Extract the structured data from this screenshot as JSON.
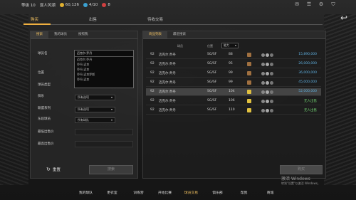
{
  "topbar": {
    "level": "等级 10",
    "mode": "混人风潮",
    "gold": "60,126",
    "points": "4/10",
    "extra": "8"
  },
  "main_tabs": [
    {
      "label": "购买"
    },
    {
      "label": "出售"
    },
    {
      "label": "待收交易"
    }
  ],
  "left": {
    "subtabs": [
      "搜索",
      "我的球员",
      "按照我"
    ],
    "fields": {
      "player_name_label": "球员名",
      "position_label": "位置",
      "card_type_label": "球员类型",
      "club_label": "俱乐",
      "league_label": "联盟系列",
      "team_label": "东段球员",
      "min_price_label": "最低出售价",
      "max_price_label": "最高出售价"
    },
    "dropdown": {
      "current": "迈克尔.乔丹",
      "options": [
        "迈克尔.乔丹",
        "乔丹.迈克",
        "乔丹.迈克",
        "乔丹.迈克罗斯",
        "乔丹.迈克"
      ]
    },
    "selects": {
      "club": "所有选项",
      "league": "所有选项",
      "team": "所有球队"
    },
    "reset_label": "重置",
    "search_label": "搜索"
  },
  "right": {
    "tabs": [
      "商品列表",
      "最近搜索"
    ],
    "headers": {
      "player": "球员",
      "position": "位置",
      "ability": "能力",
      "sort": "能力"
    },
    "rows": [
      {
        "num": "92",
        "name": "迈克尔.乔丹",
        "pos": "SG/SF",
        "ovr": "88",
        "price": "15,890,000",
        "green": false
      },
      {
        "num": "92",
        "name": "迈克尔.乔丹",
        "pos": "SG/SF",
        "ovr": "95",
        "price": "26,000,000",
        "green": false
      },
      {
        "num": "92",
        "name": "迈克尔.乔丹",
        "pos": "SG/SF",
        "ovr": "99",
        "price": "36,000,000",
        "green": false
      },
      {
        "num": "92",
        "name": "迈克尔.乔丹",
        "pos": "SG/SF",
        "ovr": "99",
        "price": "45,000,000",
        "green": false
      },
      {
        "num": "92",
        "name": "迈克尔.乔丹",
        "pos": "SG/SF",
        "ovr": "104",
        "price": "52,000,000",
        "green": false
      },
      {
        "num": "92",
        "name": "迈克尔.乔丹",
        "pos": "SG/SF",
        "ovr": "106",
        "price": "无人出售",
        "green": true
      },
      {
        "num": "92",
        "name": "迈克尔.乔丹",
        "pos": "SG/SF",
        "ovr": "110",
        "price": "无人出售",
        "green": true
      }
    ],
    "buy_label": "购买"
  },
  "bottom_nav": [
    "我的球队",
    "更衣室",
    "训练营",
    "开始比赛",
    "球员交易",
    "俱乐部",
    "帮我",
    "商城"
  ],
  "watermark": {
    "line1": "激活 Windows",
    "line2": "转到\"设置\"以激活 Windows。"
  },
  "colors": {
    "accent": "#f0b040",
    "price_blue": "#5fb0e0",
    "price_green": "#6fd070"
  }
}
